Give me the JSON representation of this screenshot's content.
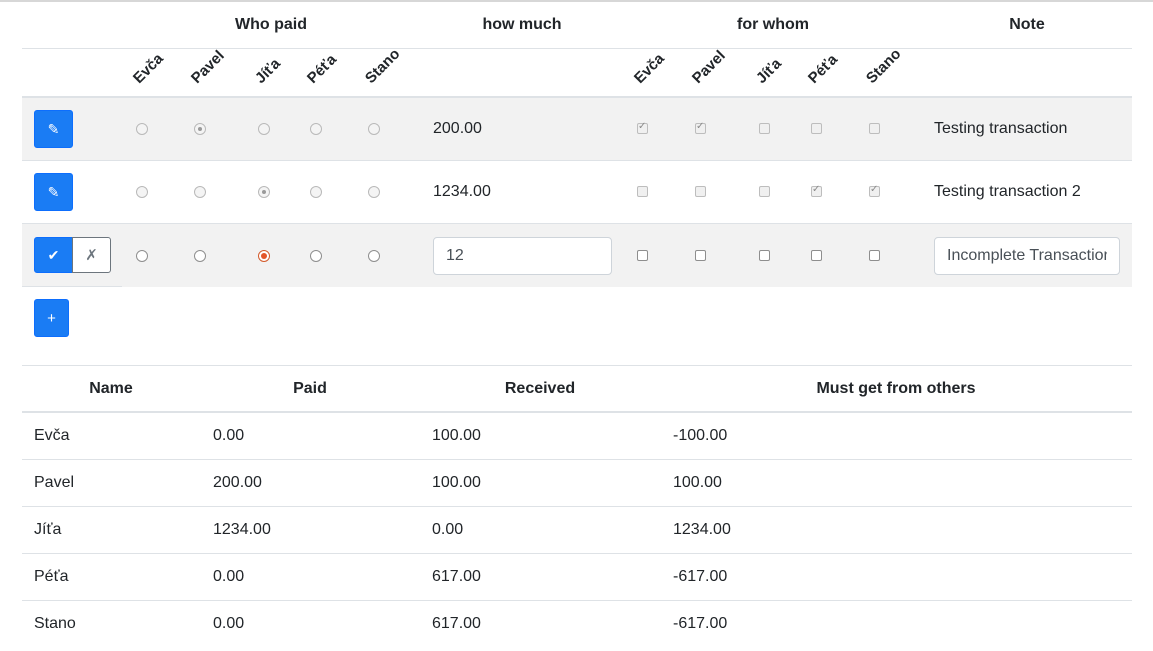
{
  "transactions_table": {
    "headers": {
      "who_paid": "Who paid",
      "how_much": "how much",
      "for_whom": "for whom",
      "note": "Note"
    },
    "people": [
      "Evča",
      "Pavel",
      "Jíťa",
      "Péťa",
      "Stano"
    ],
    "rows": [
      {
        "payer_index": 1,
        "amount": "200.00",
        "for_whom": [
          true,
          true,
          false,
          false,
          false
        ],
        "note": "Testing transaction",
        "edit_icon": "pencil-icon"
      },
      {
        "payer_index": 2,
        "amount": "1234.00",
        "for_whom": [
          false,
          false,
          false,
          true,
          true
        ],
        "note": "Testing transaction 2",
        "edit_icon": "pencil-icon"
      }
    ],
    "edit_row": {
      "payer_index": 2,
      "amount_value": "12",
      "for_whom": [
        false,
        false,
        false,
        false,
        false
      ],
      "note_value": "Incomplete Transaction",
      "confirm_label": "✔",
      "cancel_label": "✗"
    },
    "add_button_label": "+"
  },
  "summary_table": {
    "headers": {
      "name": "Name",
      "paid": "Paid",
      "received": "Received",
      "must_get": "Must get from others"
    },
    "rows": [
      {
        "name": "Evča",
        "paid": "0.00",
        "received": "100.00",
        "must_get": "-100.00"
      },
      {
        "name": "Pavel",
        "paid": "200.00",
        "received": "100.00",
        "must_get": "100.00"
      },
      {
        "name": "Jíťa",
        "paid": "1234.00",
        "received": "0.00",
        "must_get": "1234.00"
      },
      {
        "name": "Péťa",
        "paid": "0.00",
        "received": "617.00",
        "must_get": "-617.00"
      },
      {
        "name": "Stano",
        "paid": "0.00",
        "received": "617.00",
        "must_get": "-617.00"
      }
    ]
  },
  "colors": {
    "primary": "#1a7cf4",
    "selected_radio": "#e3562a",
    "striped_row": "#f2f2f2"
  }
}
